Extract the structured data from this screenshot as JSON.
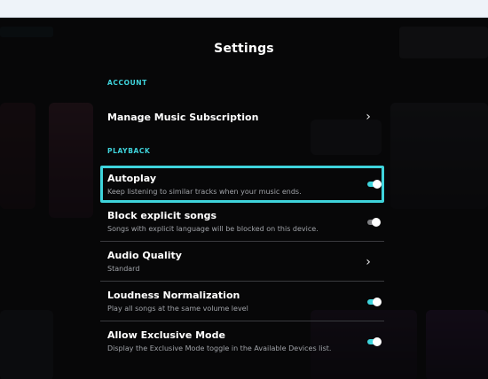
{
  "modal": {
    "title": "Settings",
    "sections": [
      {
        "heading": "ACCOUNT",
        "items": [
          {
            "label": "Manage Music Subscription",
            "control": "chevron"
          }
        ]
      },
      {
        "heading": "PLAYBACK",
        "items": [
          {
            "label": "Autoplay",
            "description": "Keep listening to similar tracks when your music ends.",
            "control": "toggle",
            "on": true,
            "focused": true
          },
          {
            "label": "Block explicit songs",
            "description": "Songs with explicit language will be blocked on this device.",
            "control": "toggle",
            "on": false
          },
          {
            "label": "Audio Quality",
            "description": "Standard",
            "control": "chevron"
          },
          {
            "label": "Loudness Normalization",
            "description": "Play all songs at the same volume level",
            "control": "toggle",
            "on": true
          },
          {
            "label": "Allow Exclusive Mode",
            "description": "Display the Exclusive Mode toggle in the Available Devices list.",
            "control": "toggle",
            "on": true
          }
        ]
      }
    ]
  },
  "colors": {
    "accent": "#3fd4dc",
    "background": "#0b0b0d",
    "toggle_off": "#7e7f82"
  },
  "icons": {
    "chevron": "chevron-right-icon"
  }
}
